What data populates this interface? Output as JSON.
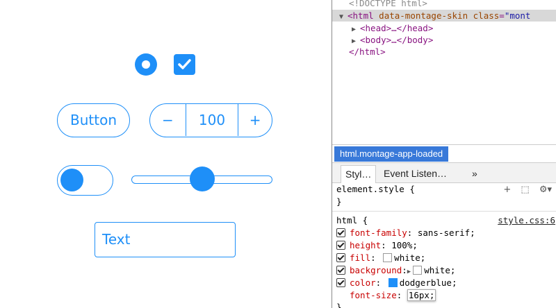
{
  "app": {
    "button_label": "Button",
    "stepper": {
      "minus": "−",
      "value": "100",
      "plus": "+"
    },
    "toggle_on": true,
    "slider_value_fraction": 0.5,
    "textfield_value": "Text",
    "radio_checked": true,
    "checkbox_checked": true,
    "accent_color": "#1e8ff8"
  },
  "devtools": {
    "elements": {
      "doctype": "<!DOCTYPE html>",
      "html_open_tag": "<html",
      "html_attr1": "data-montage-skin",
      "html_attr2": "class",
      "html_attr2_value": "\"mont",
      "head_line": "<head>…</head>",
      "body_line": "<body>…</body>",
      "html_close": "</html>"
    },
    "breadcrumb": "html.montage-app-loaded",
    "tabs": [
      "Styl…",
      "Event Listen…"
    ],
    "more_tabs": "»",
    "styles": {
      "element_style_selector": "element.style {",
      "element_style_close": "}",
      "rule_selector": "html {",
      "rule_source": "style.css:6",
      "rule_close": "}",
      "properties": [
        {
          "name": "font-family",
          "value": "sans-serif;",
          "checked": true
        },
        {
          "name": "height",
          "value": "100%;",
          "checked": true
        },
        {
          "name": "fill",
          "value": "white;",
          "checked": true,
          "swatch": "#ffffff"
        },
        {
          "name": "background",
          "value": "white;",
          "checked": true,
          "swatch": "#ffffff",
          "expand": true
        },
        {
          "name": "color",
          "value": "dodgerblue;",
          "checked": true,
          "swatch": "#1e8ff8"
        },
        {
          "name": "font-size",
          "value": "16px;",
          "checked": false,
          "editing": true
        }
      ]
    }
  }
}
